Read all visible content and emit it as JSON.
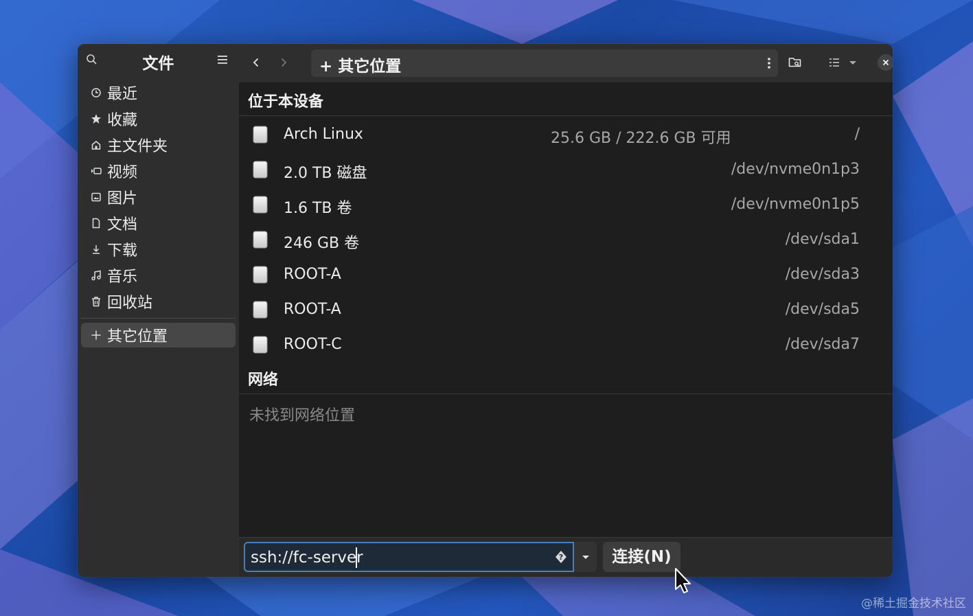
{
  "sidebar": {
    "title": "文件",
    "items": [
      {
        "label": "最近",
        "icon": "clock-icon"
      },
      {
        "label": "收藏",
        "icon": "star-icon"
      },
      {
        "label": "主文件夹",
        "icon": "home-icon"
      },
      {
        "label": "视频",
        "icon": "video-icon"
      },
      {
        "label": "图片",
        "icon": "image-icon"
      },
      {
        "label": "文档",
        "icon": "document-icon"
      },
      {
        "label": "下载",
        "icon": "download-icon"
      },
      {
        "label": "音乐",
        "icon": "music-icon"
      },
      {
        "label": "回收站",
        "icon": "trash-icon"
      }
    ],
    "other_locations": {
      "label": "其它位置",
      "icon": "plus-icon"
    }
  },
  "toolbar": {
    "path_label": "+ 其它位置"
  },
  "sections": {
    "local_title": "位于本设备",
    "network_title": "网络",
    "network_empty": "未找到网络位置"
  },
  "devices": [
    {
      "name": "Arch Linux",
      "usage": "25.6 GB / 222.6 GB 可用",
      "path": "/"
    },
    {
      "name": "2.0 TB 磁盘",
      "usage": "",
      "path": "/dev/nvme0n1p3"
    },
    {
      "name": "1.6 TB 卷",
      "usage": "",
      "path": "/dev/nvme0n1p5"
    },
    {
      "name": "246 GB 卷",
      "usage": "",
      "path": "/dev/sda1"
    },
    {
      "name": "ROOT-A",
      "usage": "",
      "path": "/dev/sda3"
    },
    {
      "name": "ROOT-A",
      "usage": "",
      "path": "/dev/sda5"
    },
    {
      "name": "ROOT-C",
      "usage": "",
      "path": "/dev/sda7"
    }
  ],
  "connect_bar": {
    "server_value": "ssh://fc-server",
    "connect_label": "连接(N)"
  },
  "watermark": "@稀土掘金技术社区"
}
